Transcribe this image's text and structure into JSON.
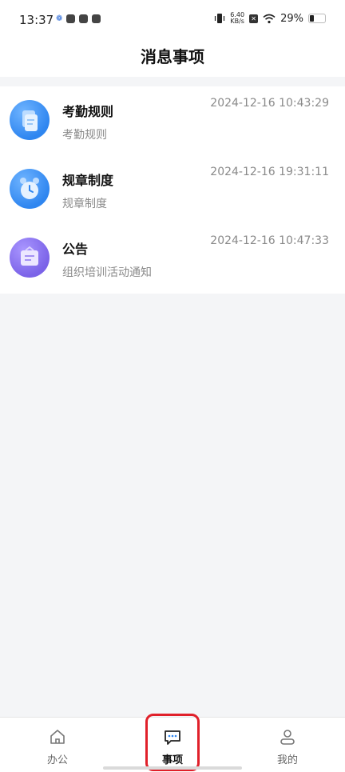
{
  "status_bar": {
    "time": "13:37",
    "net_speed_value": "6.40",
    "net_speed_unit": "KB/s",
    "battery_percent": "29%",
    "battery_level": 0.29
  },
  "header": {
    "title": "消息事项"
  },
  "messages": [
    {
      "title": "考勤规则",
      "subtitle": "考勤规则",
      "time": "2024-12-16 10:43:29",
      "icon": "document-icon",
      "color": "#2f86f0"
    },
    {
      "title": "规章制度",
      "subtitle": "规章制度",
      "time": "2024-12-16 19:31:11",
      "icon": "alarm-clock-icon",
      "color": "#2f86f0"
    },
    {
      "title": "公告",
      "subtitle": "组织培训活动通知",
      "time": "2024-12-16 10:47:33",
      "icon": "bag-icon",
      "color": "#7b63e8"
    }
  ],
  "tabbar": {
    "tabs": [
      {
        "label": "办公",
        "icon": "home-icon",
        "active": false
      },
      {
        "label": "事项",
        "icon": "chat-icon",
        "active": true
      },
      {
        "label": "我的",
        "icon": "person-icon",
        "active": false
      }
    ]
  },
  "colors": {
    "highlight": "#e0202a",
    "accent_blue": "#2f86f0",
    "accent_purple": "#7b63e8"
  }
}
